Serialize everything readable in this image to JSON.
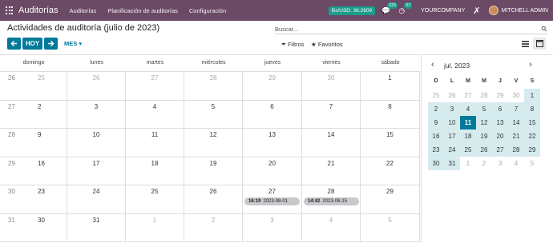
{
  "navbar": {
    "app_name": "Auditorías",
    "links": [
      "Auditorías",
      "Planificación de auditorías",
      "Configuración"
    ],
    "rate": "Bs/USD: 36.2609",
    "messages_count": "225",
    "activities_count": "57",
    "company": "YOURCOMPANY",
    "user": "MITCHELL ADMIN"
  },
  "page": {
    "title": "Actividades de auditoría (julio de 2023)",
    "search_placeholder": "Buscar...",
    "today_label": "HOY",
    "scale_label": "MES",
    "filters_label": "Filtros",
    "favorites_label": "Favoritos"
  },
  "calendar": {
    "weekdays": [
      "domingo",
      "lunes",
      "martes",
      "miércoles",
      "jueves",
      "viernes",
      "sábado"
    ],
    "weeks": [
      {
        "wk": "26",
        "days": [
          {
            "n": "25",
            "o": true
          },
          {
            "n": "26",
            "o": true
          },
          {
            "n": "27",
            "o": true
          },
          {
            "n": "28",
            "o": true
          },
          {
            "n": "29",
            "o": true
          },
          {
            "n": "30",
            "o": true
          },
          {
            "n": "1",
            "o": false
          }
        ]
      },
      {
        "wk": "27",
        "days": [
          {
            "n": "2",
            "o": false
          },
          {
            "n": "3",
            "o": false
          },
          {
            "n": "4",
            "o": false
          },
          {
            "n": "5",
            "o": false
          },
          {
            "n": "6",
            "o": false
          },
          {
            "n": "7",
            "o": false
          },
          {
            "n": "8",
            "o": false
          }
        ]
      },
      {
        "wk": "28",
        "days": [
          {
            "n": "9",
            "o": false
          },
          {
            "n": "10",
            "o": false
          },
          {
            "n": "11",
            "o": false
          },
          {
            "n": "12",
            "o": false
          },
          {
            "n": "13",
            "o": false
          },
          {
            "n": "14",
            "o": false
          },
          {
            "n": "15",
            "o": false
          }
        ]
      },
      {
        "wk": "29",
        "days": [
          {
            "n": "16",
            "o": false
          },
          {
            "n": "17",
            "o": false
          },
          {
            "n": "18",
            "o": false
          },
          {
            "n": "19",
            "o": false
          },
          {
            "n": "20",
            "o": false
          },
          {
            "n": "21",
            "o": false
          },
          {
            "n": "22",
            "o": false
          }
        ]
      },
      {
        "wk": "30",
        "days": [
          {
            "n": "23",
            "o": false
          },
          {
            "n": "24",
            "o": false
          },
          {
            "n": "25",
            "o": false
          },
          {
            "n": "26",
            "o": false
          },
          {
            "n": "27",
            "o": false
          },
          {
            "n": "28",
            "o": false
          },
          {
            "n": "29",
            "o": false
          }
        ]
      },
      {
        "wk": "31",
        "days": [
          {
            "n": "30",
            "o": false
          },
          {
            "n": "31",
            "o": false
          },
          {
            "n": "1",
            "o": true
          },
          {
            "n": "2",
            "o": true
          },
          {
            "n": "3",
            "o": true
          },
          {
            "n": "4",
            "o": true
          },
          {
            "n": "5",
            "o": true
          }
        ]
      }
    ],
    "events": [
      {
        "week": 4,
        "day": 4,
        "time": "16:19",
        "label": "2023-08-01"
      },
      {
        "week": 4,
        "day": 5,
        "time": "14:42",
        "label": "2023-08-15"
      }
    ]
  },
  "mini_calendar": {
    "title": "jul. 2023",
    "day_headers": [
      "D",
      "L",
      "M",
      "M",
      "J",
      "V",
      "S"
    ],
    "days": [
      {
        "n": "25",
        "o": true
      },
      {
        "n": "26",
        "o": true
      },
      {
        "n": "27",
        "o": true
      },
      {
        "n": "28",
        "o": true
      },
      {
        "n": "29",
        "o": true
      },
      {
        "n": "30",
        "o": true
      },
      {
        "n": "1",
        "o": false
      },
      {
        "n": "2",
        "o": false
      },
      {
        "n": "3",
        "o": false
      },
      {
        "n": "4",
        "o": false
      },
      {
        "n": "5",
        "o": false
      },
      {
        "n": "6",
        "o": false
      },
      {
        "n": "7",
        "o": false
      },
      {
        "n": "8",
        "o": false
      },
      {
        "n": "9",
        "o": false
      },
      {
        "n": "10",
        "o": false
      },
      {
        "n": "11",
        "o": false,
        "today": true
      },
      {
        "n": "12",
        "o": false
      },
      {
        "n": "13",
        "o": false
      },
      {
        "n": "14",
        "o": false
      },
      {
        "n": "15",
        "o": false
      },
      {
        "n": "16",
        "o": false
      },
      {
        "n": "17",
        "o": false
      },
      {
        "n": "18",
        "o": false
      },
      {
        "n": "19",
        "o": false
      },
      {
        "n": "20",
        "o": false
      },
      {
        "n": "21",
        "o": false
      },
      {
        "n": "22",
        "o": false
      },
      {
        "n": "23",
        "o": false
      },
      {
        "n": "24",
        "o": false
      },
      {
        "n": "25",
        "o": false
      },
      {
        "n": "26",
        "o": false
      },
      {
        "n": "27",
        "o": false
      },
      {
        "n": "28",
        "o": false
      },
      {
        "n": "29",
        "o": false
      },
      {
        "n": "30",
        "o": false
      },
      {
        "n": "31",
        "o": false
      },
      {
        "n": "1",
        "o": true
      },
      {
        "n": "2",
        "o": true
      },
      {
        "n": "3",
        "o": true
      },
      {
        "n": "4",
        "o": true
      },
      {
        "n": "5",
        "o": true
      }
    ]
  },
  "colors": {
    "navbar": "#6b4a66",
    "accent": "#00799a",
    "badge": "#1d9b8b"
  }
}
